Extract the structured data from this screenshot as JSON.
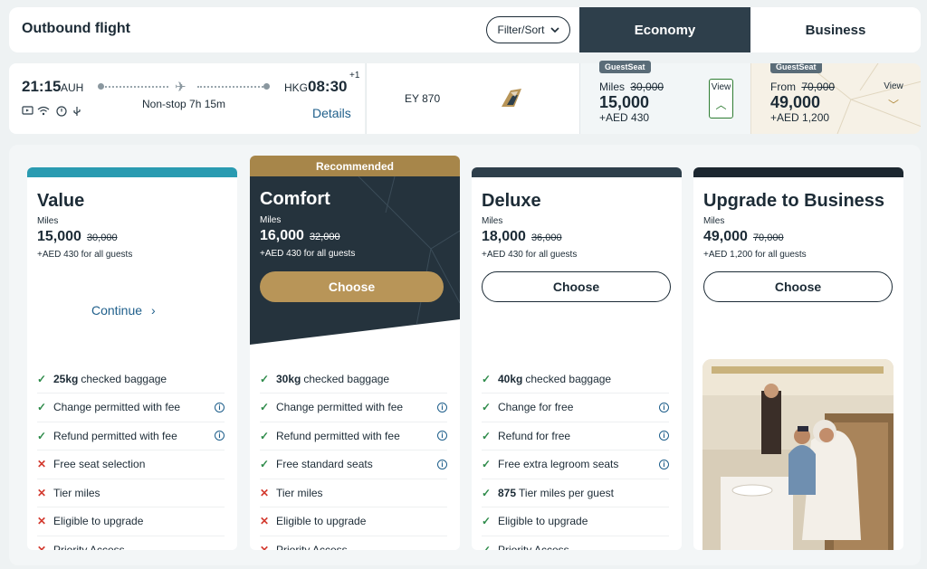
{
  "header": {
    "title": "Outbound flight",
    "filter_label": "Filter/Sort",
    "tabs": [
      "Economy",
      "Business"
    ]
  },
  "flight": {
    "depart_time": "21:15",
    "depart_airport": "AUH",
    "arrive_airport": "HKG",
    "arrive_time": "08:30",
    "day_offset": "+1",
    "duration": "Non-stop 7h 15m",
    "details_label": "Details",
    "flight_number": "EY 870",
    "amenities": [
      "tv-icon",
      "wifi-icon",
      "power-icon",
      "usb-icon"
    ]
  },
  "economy_fare": {
    "badge": "GuestSeat",
    "label": "Miles",
    "old_miles": "30,000",
    "miles": "15,000",
    "aed": "+AED  430",
    "view_label": "View"
  },
  "business_fare": {
    "badge": "GuestSeat",
    "label": "From",
    "old_miles": "70,000",
    "miles": "49,000",
    "aed": "+AED  1,200",
    "view_label": "View"
  },
  "cards": [
    {
      "name": "Value",
      "miles_label": "Miles",
      "miles": "15,000",
      "old_miles": "30,000",
      "aed": "+AED 430 for all guests",
      "cta": "Continue",
      "features": [
        {
          "bold": "25kg",
          "text": "checked baggage",
          "ok": true,
          "info": false
        },
        {
          "bold": "",
          "text": "Change permitted with fee",
          "ok": true,
          "info": true
        },
        {
          "bold": "",
          "text": "Refund permitted with fee",
          "ok": true,
          "info": true
        },
        {
          "bold": "",
          "text": "Free seat selection",
          "ok": false,
          "info": false
        },
        {
          "bold": "",
          "text": "Tier miles",
          "ok": false,
          "info": false
        },
        {
          "bold": "",
          "text": "Eligible to upgrade",
          "ok": false,
          "info": false
        },
        {
          "bold": "",
          "text": "Priority Access",
          "ok": false,
          "info": false
        }
      ]
    },
    {
      "name": "Comfort",
      "recommended": "Recommended",
      "miles_label": "Miles",
      "miles": "16,000",
      "old_miles": "32,000",
      "aed": "+AED 430 for all guests",
      "cta": "Choose",
      "features": [
        {
          "bold": "30kg",
          "text": "checked baggage",
          "ok": true,
          "info": false
        },
        {
          "bold": "",
          "text": "Change permitted with fee",
          "ok": true,
          "info": true
        },
        {
          "bold": "",
          "text": "Refund permitted with fee",
          "ok": true,
          "info": true
        },
        {
          "bold": "",
          "text": "Free standard seats",
          "ok": true,
          "info": true
        },
        {
          "bold": "",
          "text": "Tier miles",
          "ok": false,
          "info": false
        },
        {
          "bold": "",
          "text": "Eligible to upgrade",
          "ok": false,
          "info": false
        },
        {
          "bold": "",
          "text": "Priority Access",
          "ok": false,
          "info": false
        }
      ]
    },
    {
      "name": "Deluxe",
      "miles_label": "Miles",
      "miles": "18,000",
      "old_miles": "36,000",
      "aed": "+AED 430 for all guests",
      "cta": "Choose",
      "features": [
        {
          "bold": "40kg",
          "text": "checked baggage",
          "ok": true,
          "info": false
        },
        {
          "bold": "",
          "text": "Change for free",
          "ok": true,
          "info": true
        },
        {
          "bold": "",
          "text": "Refund for free",
          "ok": true,
          "info": true
        },
        {
          "bold": "",
          "text": "Free extra legroom seats",
          "ok": true,
          "info": true
        },
        {
          "bold": "875",
          "text": "Tier miles per guest",
          "ok": true,
          "info": false
        },
        {
          "bold": "",
          "text": "Eligible to upgrade",
          "ok": true,
          "info": false
        },
        {
          "bold": "",
          "text": "Priority Access",
          "ok": true,
          "info": false
        }
      ]
    },
    {
      "name": "Upgrade to Business",
      "miles_label": "Miles",
      "miles": "49,000",
      "old_miles": "70,000",
      "aed": "+AED 1,200 for all guests",
      "cta": "Choose"
    }
  ],
  "colors": {
    "navy": "#2e3f4b",
    "gold": "#b89558",
    "link": "#1f5f8b",
    "check": "#2e8b4a",
    "cross": "#d33a2f",
    "value_band": "#2a9bb1"
  }
}
